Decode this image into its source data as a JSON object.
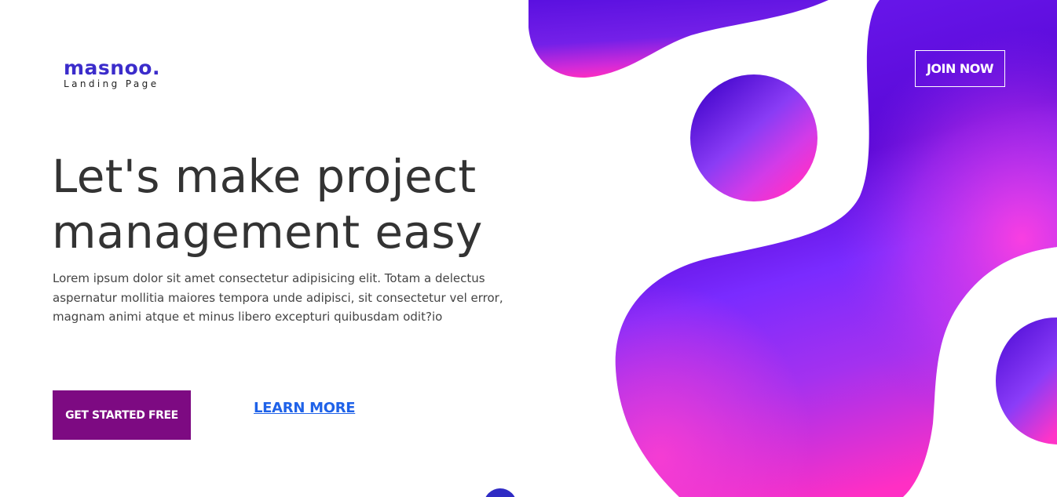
{
  "brand": {
    "name": "masnoo.",
    "tagline": "Landing Page"
  },
  "header": {
    "join_label": "JOIN NOW"
  },
  "hero": {
    "title_line1": "Let's make project",
    "title_line2": "management easy",
    "description": "Lorem ipsum dolor sit amet consectetur adipisicing elit. Totam a delectus aspernatur mollitia maiores tempora unde adipisci, sit consectetur vel error, magnam animi atque et minus libero excepturi quibusdam odit?io",
    "primary_cta": "GET STARTED FREE",
    "secondary_cta": "LEARN MORE"
  },
  "colors": {
    "brand": "#3b2ccb",
    "heading": "#333333",
    "cta_bg": "#7d0a82",
    "link": "#1f62e8",
    "blob_violet": "#5b0bd6",
    "blob_magenta": "#ff2fd0"
  }
}
